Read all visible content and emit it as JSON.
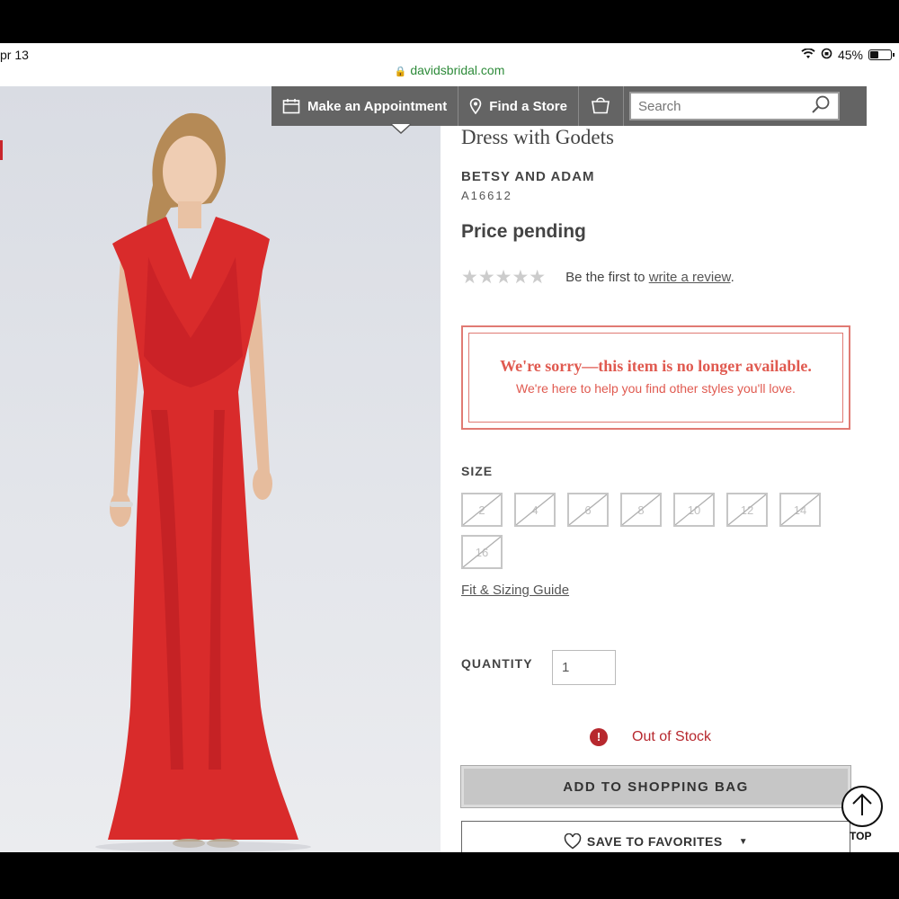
{
  "status_bar": {
    "time": "pr 13",
    "battery": "45%",
    "battery_level": 0.45
  },
  "browser": {
    "url": "davidsbridal.com"
  },
  "nav": {
    "appointment_label": "Make an Appointment",
    "store_label": "Find a Store",
    "search_placeholder": "Search"
  },
  "product": {
    "title": "Dress with Godets",
    "brand": "BETSY AND ADAM",
    "sku": "A16612",
    "price": "Price pending",
    "rating_stars": "★★★★★",
    "review_prefix": "Be the first to",
    "review_link": "write a review",
    "review_suffix": "."
  },
  "notice": {
    "title": "We're sorry—this item is no longer available.",
    "subtitle": "We're here to help you find other styles you'll love."
  },
  "size": {
    "label": "SIZE",
    "options": [
      "2",
      "4",
      "6",
      "8",
      "10",
      "12",
      "14",
      "16"
    ],
    "guide_link": "Fit & Sizing Guide"
  },
  "quantity": {
    "label": "QUANTITY",
    "value": "1"
  },
  "stock": {
    "icon_text": "!",
    "status": "Out of Stock"
  },
  "actions": {
    "add_to_bag": "ADD TO SHOPPING BAG",
    "save_favorites": "SAVE TO FAVORITES",
    "caret": "▼",
    "top_label": "TOP"
  },
  "colors": {
    "dress": "#d92b2b",
    "notice": "#e05a50",
    "out_of_stock": "#b7282e",
    "nav_bg": "#646464",
    "url_green": "#2e8b3a"
  }
}
